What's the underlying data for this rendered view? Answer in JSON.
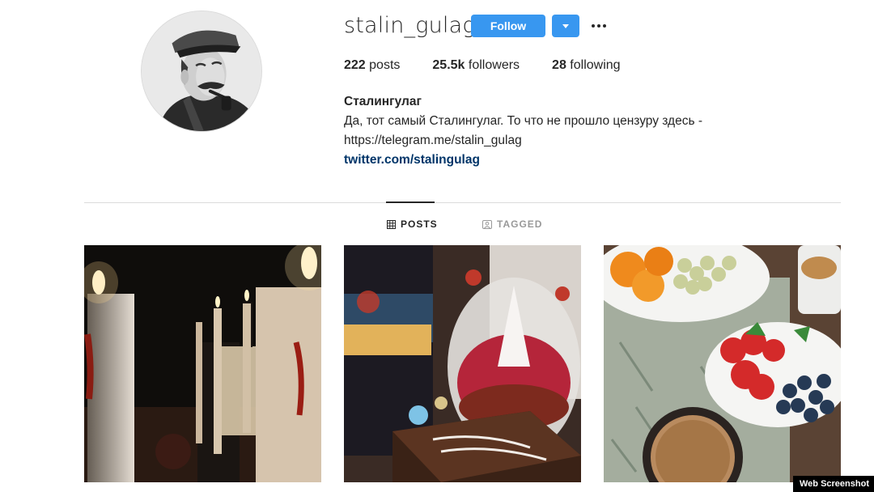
{
  "profile": {
    "username": "stalin_gulag",
    "follow_label": "Follow",
    "avatar_icon": "profile-photo",
    "posts_count": "222",
    "posts_label": "posts",
    "followers_count": "25.5k",
    "followers_label": "followers",
    "following_count": "28",
    "following_label": "following",
    "full_name": "Сталингулаг",
    "bio_text": "Да, тот самый Сталингулаг. То что не прошло цензуру здесь -",
    "bio_link": "https://telegram.me/stalin_gulag",
    "external_link": "twitter.com/stalingulag"
  },
  "tabs": [
    {
      "label": "POSTS",
      "icon": "grid-icon",
      "active": true
    },
    {
      "label": "TAGGED",
      "icon": "tagged-icon",
      "active": false
    }
  ],
  "posts": [
    {
      "description": "candles and wine bottle"
    },
    {
      "description": "wine, glass ornament and cake"
    },
    {
      "description": "oranges, grapes, strawberries and coffee"
    }
  ],
  "watermark": "Web Screenshot",
  "colors": {
    "accent": "#3897f0",
    "link": "#003569",
    "text": "#262626",
    "muted": "#999999",
    "divider": "#dbdbdb"
  }
}
